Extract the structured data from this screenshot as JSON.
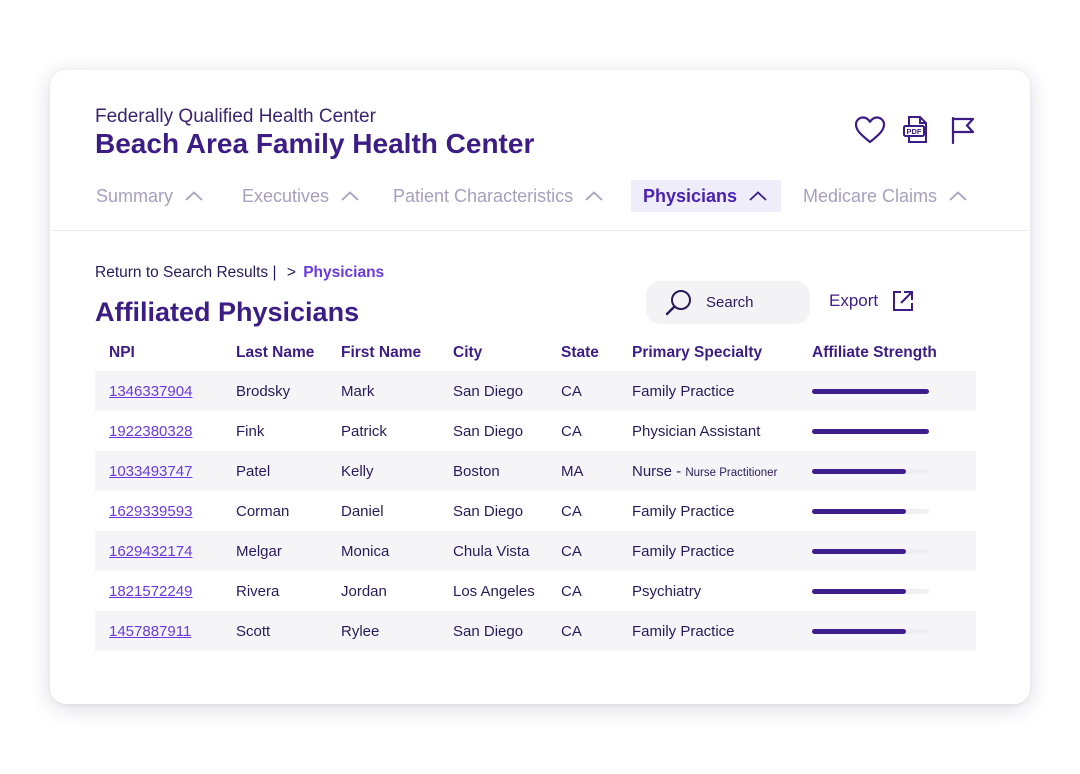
{
  "header": {
    "org_type": "Federally Qualified Health Center",
    "org_name": "Beach Area Family Health Center",
    "icons": [
      "heart-icon",
      "pdf-icon",
      "flag-icon"
    ]
  },
  "tabs": [
    {
      "label": "Summary",
      "active": false
    },
    {
      "label": "Executives",
      "active": false
    },
    {
      "label": "Patient Characteristics",
      "active": false
    },
    {
      "label": "Physicians",
      "active": true
    },
    {
      "label": "Medicare Claims",
      "active": false
    }
  ],
  "breadcrumb": {
    "back_label": "Return to Search Results |",
    "separator": ">",
    "current": "Physicians"
  },
  "section_title": "Affiliated Physicians",
  "search": {
    "placeholder": "Search"
  },
  "export_label": "Export",
  "colors": {
    "primary": "#3c1d86",
    "accent": "#6a3ae0",
    "tab_active_bg": "#f0edfb",
    "muted": "#a79fbe",
    "stripe": "#f5f5f7"
  },
  "table": {
    "columns": [
      "NPI",
      "Last Name",
      "First Name",
      "City",
      "State",
      "Primary Specialty",
      "Affiliate Strength"
    ],
    "rows": [
      {
        "npi": "1346337904",
        "last": "Brodsky",
        "first": "Mark",
        "city": "San Diego",
        "state": "CA",
        "specialty": "Family Practice",
        "specialty_detail": "",
        "strength": 1.0
      },
      {
        "npi": "1922380328",
        "last": "Fink",
        "first": "Patrick",
        "city": "San Diego",
        "state": "CA",
        "specialty": "Physician Assistant",
        "specialty_detail": "",
        "strength": 1.0
      },
      {
        "npi": "1033493747",
        "last": "Patel",
        "first": "Kelly",
        "city": "Boston",
        "state": "MA",
        "specialty": "Nurse -",
        "specialty_detail": "Nurse Practitioner",
        "strength": 0.8
      },
      {
        "npi": "1629339593",
        "last": "Corman",
        "first": "Daniel",
        "city": "San Diego",
        "state": "CA",
        "specialty": "Family Practice",
        "specialty_detail": "",
        "strength": 0.8
      },
      {
        "npi": "1629432174",
        "last": "Melgar",
        "first": "Monica",
        "city": "Chula Vista",
        "state": "CA",
        "specialty": "Family Practice",
        "specialty_detail": "",
        "strength": 0.8
      },
      {
        "npi": "1821572249",
        "last": "Rivera",
        "first": "Jordan",
        "city": "Los Angeles",
        "state": "CA",
        "specialty": "Psychiatry",
        "specialty_detail": "",
        "strength": 0.8
      },
      {
        "npi": "1457887911",
        "last": "Scott",
        "first": "Rylee",
        "city": "San Diego",
        "state": "CA",
        "specialty": "Family Practice",
        "specialty_detail": "",
        "strength": 0.8
      }
    ]
  }
}
